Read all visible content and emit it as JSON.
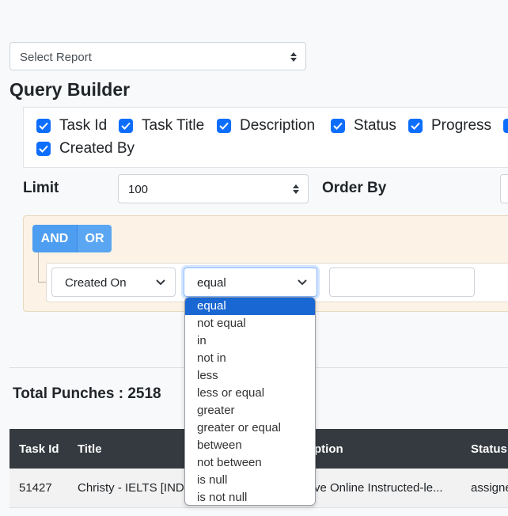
{
  "report_select": {
    "value": "Select Report"
  },
  "query_builder": {
    "title": "Query Builder",
    "fields_line1": [
      "Task Id",
      "Task Title",
      "Description",
      "Status",
      "Progress"
    ],
    "fields_line2": [
      "Created By"
    ],
    "limit_label": "Limit",
    "limit_value": "100",
    "order_by_label": "Order By",
    "and_label": "AND",
    "or_label": "OR",
    "rule": {
      "field": "Created On",
      "operator": "equal",
      "value": ""
    },
    "operator_options": [
      "equal",
      "not equal",
      "in",
      "not in",
      "less",
      "less or equal",
      "greater",
      "greater or equal",
      "between",
      "not between",
      "is null",
      "is not null"
    ],
    "selected_operator": "equal"
  },
  "summary": {
    "total_punches": "Total Punches : 2518"
  },
  "table": {
    "headers": [
      "Task Id",
      "Title",
      "ption",
      "Status"
    ],
    "rows": [
      [
        "51427",
        "Christy - IELTS [IND",
        "ve Online Instructed-le...",
        "assigne"
      ]
    ]
  },
  "colors": {
    "accent": "#0d6efd",
    "header_dark": "#343a40",
    "group_bg": "#fcf3e6",
    "selected_option": "#1967d2"
  }
}
